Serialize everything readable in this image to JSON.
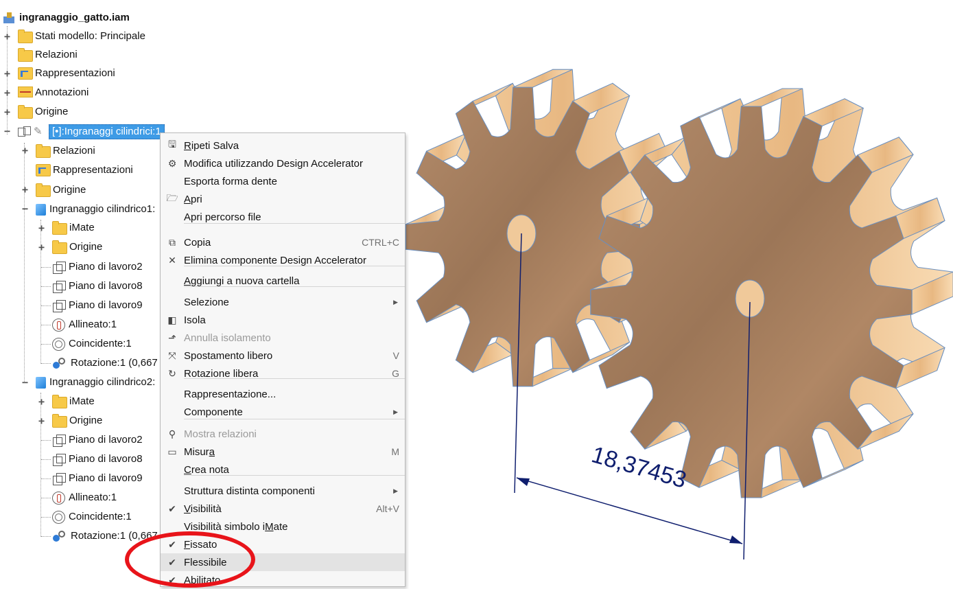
{
  "tree": {
    "root": "ingranaggio_gatto.iam",
    "nodes": [
      {
        "label": "Stati modello: Principale"
      },
      {
        "label": "Relazioni"
      },
      {
        "label": "Rappresentazioni"
      },
      {
        "label": "Annotazioni"
      },
      {
        "label": "Origine"
      },
      {
        "label": "[•]:Ingranaggi cilindrici:1"
      },
      {
        "label": "Relazioni"
      },
      {
        "label": "Rappresentazioni"
      },
      {
        "label": "Origine"
      },
      {
        "label": "Ingranaggio cilindrico1:"
      },
      {
        "label": "iMate"
      },
      {
        "label": "Origine"
      },
      {
        "label": "Piano di lavoro2"
      },
      {
        "label": "Piano di lavoro8"
      },
      {
        "label": "Piano di lavoro9"
      },
      {
        "label": "Allineato:1"
      },
      {
        "label": "Coincidente:1"
      },
      {
        "label": "Rotazione:1 (0,667"
      },
      {
        "label": "Ingranaggio cilindrico2:"
      },
      {
        "label": "iMate"
      },
      {
        "label": "Origine"
      },
      {
        "label": "Piano di lavoro2"
      },
      {
        "label": "Piano di lavoro8"
      },
      {
        "label": "Piano di lavoro9"
      },
      {
        "label": "Allineato:1"
      },
      {
        "label": "Coincidente:1"
      },
      {
        "label": "Rotazione:1 (0,667"
      }
    ]
  },
  "menu": {
    "items": [
      {
        "pre": "",
        "ul": "R",
        "post": "ipeti Salva",
        "shortcut": "",
        "icon": "save-icon"
      },
      {
        "pre": "Modifica utilizzando Design Accelerator",
        "ul": "",
        "post": "",
        "shortcut": "",
        "icon": "design-accelerator-icon"
      },
      {
        "pre": "Esporta forma dente",
        "ul": "",
        "post": "",
        "shortcut": "",
        "icon": ""
      },
      {
        "pre": "",
        "ul": "A",
        "post": "pri",
        "shortcut": "",
        "icon": "open-icon"
      },
      {
        "pre": "Apri percorso file",
        "ul": "",
        "post": "",
        "shortcut": "",
        "icon": ""
      },
      {
        "pre": "Copia",
        "ul": "",
        "post": "",
        "shortcut": "CTRL+C",
        "icon": "copy-icon"
      },
      {
        "pre": "Elimina componente Design Accelerator",
        "ul": "",
        "post": "",
        "shortcut": "",
        "icon": "delete-icon"
      },
      {
        "pre": "",
        "ul": "A",
        "post": "ggiungi a nuova cartella",
        "shortcut": "",
        "icon": ""
      },
      {
        "pre": "Selezione",
        "ul": "",
        "post": "",
        "shortcut": "",
        "icon": "",
        "submenu": true
      },
      {
        "pre": "Isola",
        "ul": "",
        "post": "",
        "shortcut": "",
        "icon": "isolate-icon"
      },
      {
        "pre": "Annulla isolamento",
        "ul": "",
        "post": "",
        "shortcut": "",
        "icon": "undo-isolate-icon",
        "disabled": true
      },
      {
        "pre": "Spostamento libero",
        "ul": "",
        "post": "",
        "shortcut": "V",
        "icon": "free-move-icon"
      },
      {
        "pre": "Rotazione libera",
        "ul": "",
        "post": "",
        "shortcut": "G",
        "icon": "free-rotate-icon"
      },
      {
        "pre": "Rappresentazione...",
        "ul": "",
        "post": "",
        "shortcut": "",
        "icon": ""
      },
      {
        "pre": "Componente",
        "ul": "",
        "post": "",
        "shortcut": "",
        "icon": "",
        "submenu": true
      },
      {
        "pre": "Mostra relazioni",
        "ul": "",
        "post": "",
        "shortcut": "",
        "icon": "show-relations-icon",
        "disabled": true
      },
      {
        "pre": "Misur",
        "ul": "a",
        "post": "",
        "shortcut": "M",
        "icon": "measure-icon"
      },
      {
        "pre": "",
        "ul": "C",
        "post": "rea nota",
        "shortcut": "",
        "icon": ""
      },
      {
        "pre": "Struttura distinta componenti",
        "ul": "",
        "post": "",
        "shortcut": "",
        "icon": "",
        "submenu": true
      },
      {
        "pre": "",
        "ul": "V",
        "post": "isibilità",
        "shortcut": "Alt+V",
        "icon": "check-icon"
      },
      {
        "pre": "Visibilità simbolo i",
        "ul": "M",
        "post": "ate",
        "shortcut": "",
        "icon": ""
      },
      {
        "pre": "",
        "ul": "F",
        "post": "issato",
        "shortcut": "",
        "icon": "check-icon"
      },
      {
        "pre": "Flessibile",
        "ul": "",
        "post": "",
        "shortcut": "",
        "icon": "check-icon",
        "highlighted": true
      },
      {
        "pre": "Abilitato",
        "ul": "",
        "post": "",
        "shortcut": "",
        "icon": "check-icon"
      }
    ]
  },
  "viewport": {
    "dimension_text": "18,37453",
    "dimension_color": "#0f1e6e",
    "highlight_color": "#e8141a"
  }
}
